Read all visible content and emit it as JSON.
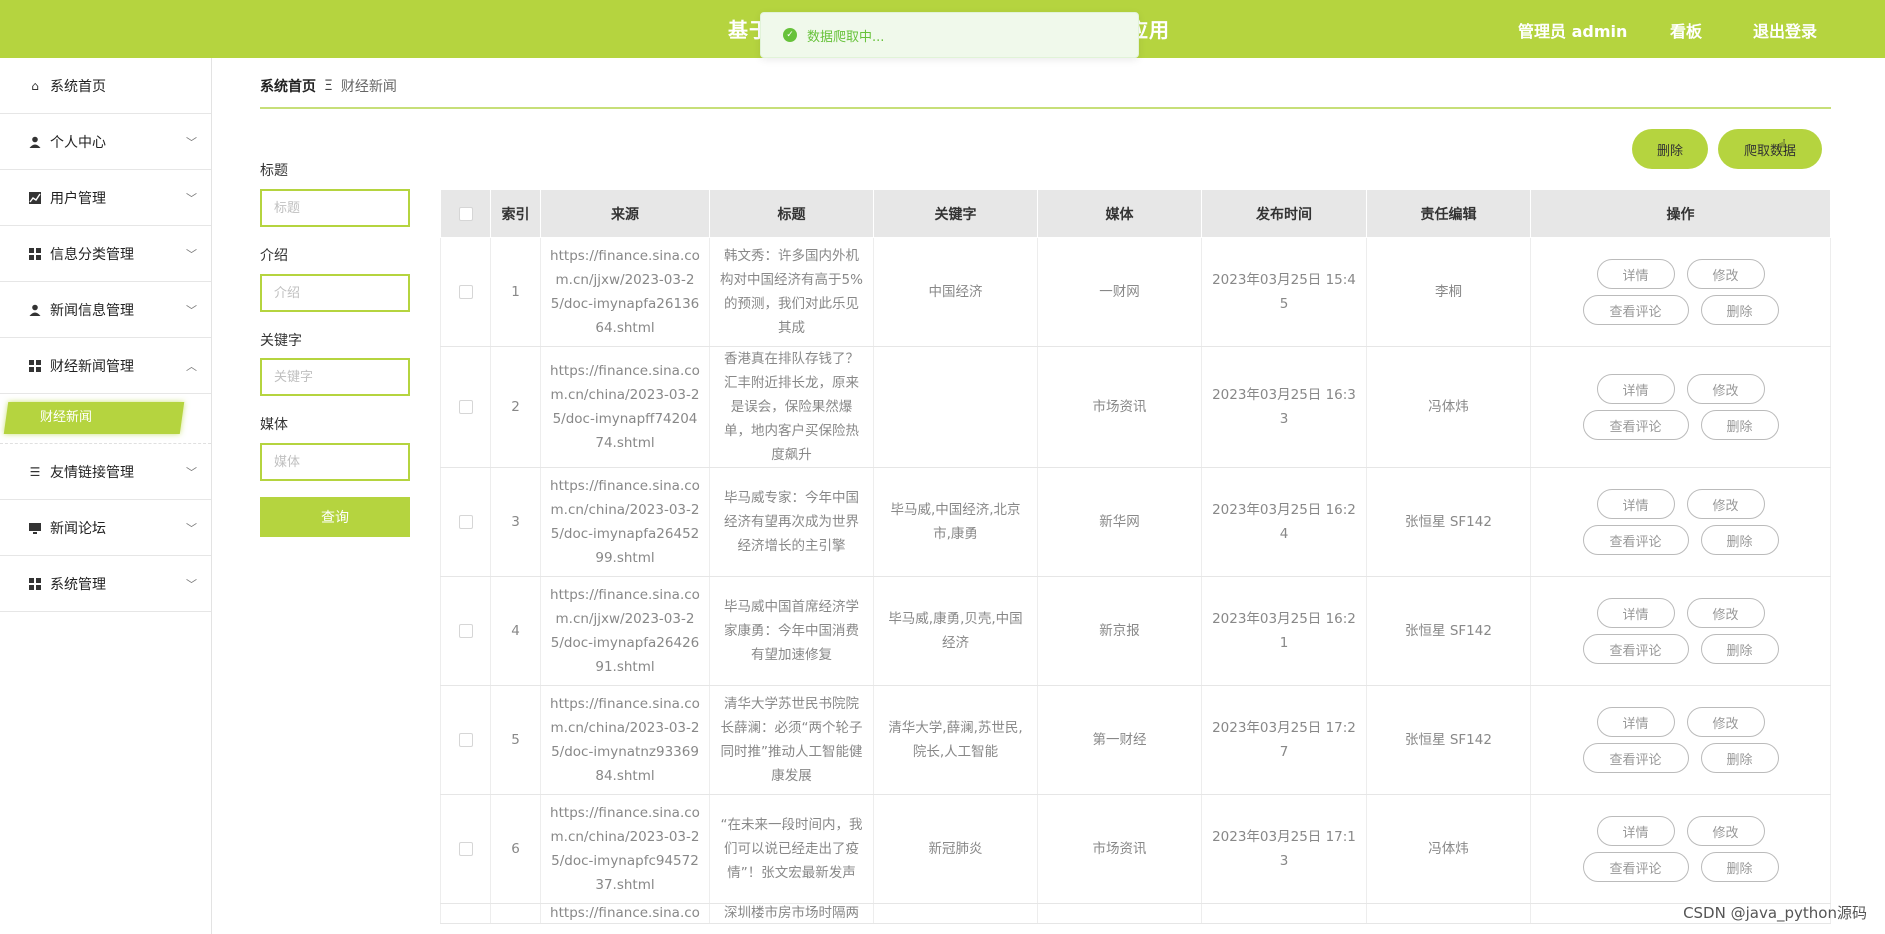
{
  "header": {
    "app_title_visible_start": "基于",
    "app_title_visible_end": "应用",
    "admin_label": "管理员 admin",
    "board_label": "看板",
    "logout_label": "退出登录",
    "toast_text": "数据爬取中...",
    "toast_icon": "check-circle-icon"
  },
  "sidebar": {
    "items": [
      {
        "label": "系统首页",
        "icon": "home-icon"
      },
      {
        "label": "个人中心",
        "icon": "user-icon"
      },
      {
        "label": "用户管理",
        "icon": "chart-icon"
      },
      {
        "label": "信息分类管理",
        "icon": "grid-icon"
      },
      {
        "label": "新闻信息管理",
        "icon": "user-icon"
      },
      {
        "label": "财经新闻管理",
        "icon": "grid-icon"
      },
      {
        "label": "友情链接管理",
        "icon": "list-icon"
      },
      {
        "label": "新闻论坛",
        "icon": "monitor-icon"
      },
      {
        "label": "系统管理",
        "icon": "grid-icon"
      }
    ],
    "sub_item": "财经新闻"
  },
  "breadcrumb": {
    "home": "系统首页",
    "separator": "Ξ",
    "current": "财经新闻"
  },
  "filters": {
    "title_label": "标题",
    "title_placeholder": "标题",
    "intro_label": "介绍",
    "intro_placeholder": "介绍",
    "keyword_label": "关键字",
    "keyword_placeholder": "关键字",
    "media_label": "媒体",
    "media_placeholder": "媒体",
    "query_button": "查询"
  },
  "actions": {
    "delete": "删除",
    "crawl": "爬取数据"
  },
  "table": {
    "headers": [
      "索引",
      "来源",
      "标题",
      "关键字",
      "媒体",
      "发布时间",
      "责任编辑",
      "操作"
    ],
    "op_labels": {
      "detail": "详情",
      "edit": "修改",
      "comments": "查看评论",
      "delete": "删除"
    },
    "rows": [
      {
        "index": "1",
        "source": "https://finance.sina.com.cn/jjxw/2023-03-25/doc-imynapfa2613664.shtml",
        "title": "韩文秀：许多国内外机构对中国经济有高于5%的预测，我们对此乐见其成",
        "keywords": "中国经济",
        "media": "一财网",
        "time": "2023年03月25日 15:45",
        "editor": "李桐"
      },
      {
        "index": "2",
        "source": "https://finance.sina.com.cn/china/2023-03-25/doc-imynapff7420474.shtml",
        "title": "香港真在排队存钱了？汇丰附近排长龙，原来是误会，保险果然爆单，地内客户买保险热度飙升",
        "keywords": "",
        "media": "市场资讯",
        "time": "2023年03月25日 16:33",
        "editor": "冯体炜"
      },
      {
        "index": "3",
        "source": "https://finance.sina.com.cn/china/2023-03-25/doc-imynapfa2645299.shtml",
        "title": "毕马威专家：今年中国经济有望再次成为世界经济增长的主引擎",
        "keywords": "毕马威,中国经济,北京市,康勇",
        "media": "新华网",
        "time": "2023年03月25日 16:24",
        "editor": "张恒星 SF142"
      },
      {
        "index": "4",
        "source": "https://finance.sina.com.cn/jjxw/2023-03-25/doc-imynapfa2642691.shtml",
        "title": "毕马威中国首席经济学家康勇：今年中国消费有望加速修复",
        "keywords": "毕马威,康勇,贝壳,中国经济",
        "media": "新京报",
        "time": "2023年03月25日 16:21",
        "editor": "张恒星 SF142"
      },
      {
        "index": "5",
        "source": "https://finance.sina.com.cn/china/2023-03-25/doc-imynatnz9336984.shtml",
        "title": "清华大学苏世民书院院长薛澜：必须“两个轮子同时推”推动人工智能健康发展",
        "keywords": "清华大学,薛澜,苏世民,院长,人工智能",
        "media": "第一财经",
        "time": "2023年03月25日 17:27",
        "editor": "张恒星 SF142"
      },
      {
        "index": "6",
        "source": "https://finance.sina.com.cn/china/2023-03-25/doc-imynapfc9457237.shtml",
        "title": "“在未来一段时间内，我们可以说已经走出了疫情”！张文宏最新发声",
        "keywords": "新冠肺炎",
        "media": "市场资讯",
        "time": "2023年03月25日 17:13",
        "editor": "冯体炜"
      }
    ],
    "partial_row": {
      "source": "https://finance.sina.co",
      "title": "深圳楼市房市场时隔两"
    }
  },
  "watermark": "CSDN @java_python源码",
  "colors": {
    "accent": "#b5d43f",
    "header_bg": "#e7e7e7",
    "toast_bg": "#f0f9eb",
    "toast_text": "#67c23a"
  }
}
